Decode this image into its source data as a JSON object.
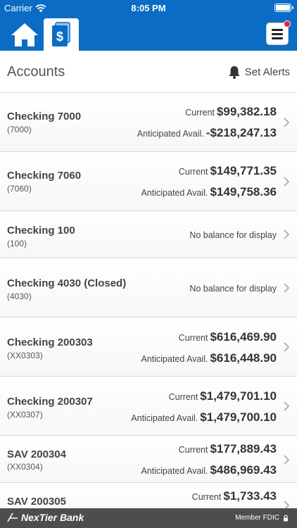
{
  "status_bar": {
    "carrier": "Carrier",
    "time": "8:05 PM"
  },
  "header": {
    "home_icon": "home-icon",
    "accounts_icon": "dollar-document-icon",
    "menu_icon": "hamburger-menu-icon"
  },
  "page": {
    "title": "Accounts",
    "set_alerts_label": "Set Alerts"
  },
  "accounts": [
    {
      "name": "Checking 7000",
      "sub": "(7000)",
      "current_label": "Current",
      "current": "$99,382.18",
      "avail_label": "Anticipated Avail.",
      "avail": "-$218,247.13"
    },
    {
      "name": "Checking 7060",
      "sub": "(7060)",
      "current_label": "Current",
      "current": "$149,771.35",
      "avail_label": "Anticipated Avail.",
      "avail": "$149,758.36"
    },
    {
      "name": "Checking 100",
      "sub": "(100)",
      "no_balance": "No balance for display"
    },
    {
      "name": "Checking 4030 (Closed)",
      "sub": "(4030)",
      "no_balance": "No balance for display"
    },
    {
      "name": "Checking 200303",
      "sub": "(XX0303)",
      "current_label": "Current",
      "current": "$616,469.90",
      "avail_label": "Anticipated Avail.",
      "avail": "$616,448.90"
    },
    {
      "name": "Checking 200307",
      "sub": "(XX0307)",
      "current_label": "Current",
      "current": "$1,479,701.10",
      "avail_label": "Anticipated Avail.",
      "avail": "$1,479,700.10"
    },
    {
      "name": "SAV 200304",
      "sub": "(XX0304)",
      "current_label": "Current",
      "current": "$177,889.43",
      "avail_label": "Anticipated Avail.",
      "avail": "$486,969.43"
    },
    {
      "name": "SAV 200305",
      "sub": "",
      "current_label": "Current",
      "current": "$1,733.43"
    }
  ],
  "footer": {
    "bank_name": "NexTier Bank",
    "fdic": "Member FDIC"
  },
  "colors": {
    "brand_blue": "#0a6cc4",
    "footer_gray": "#4d4d4d",
    "alert_red": "#e0243a"
  }
}
